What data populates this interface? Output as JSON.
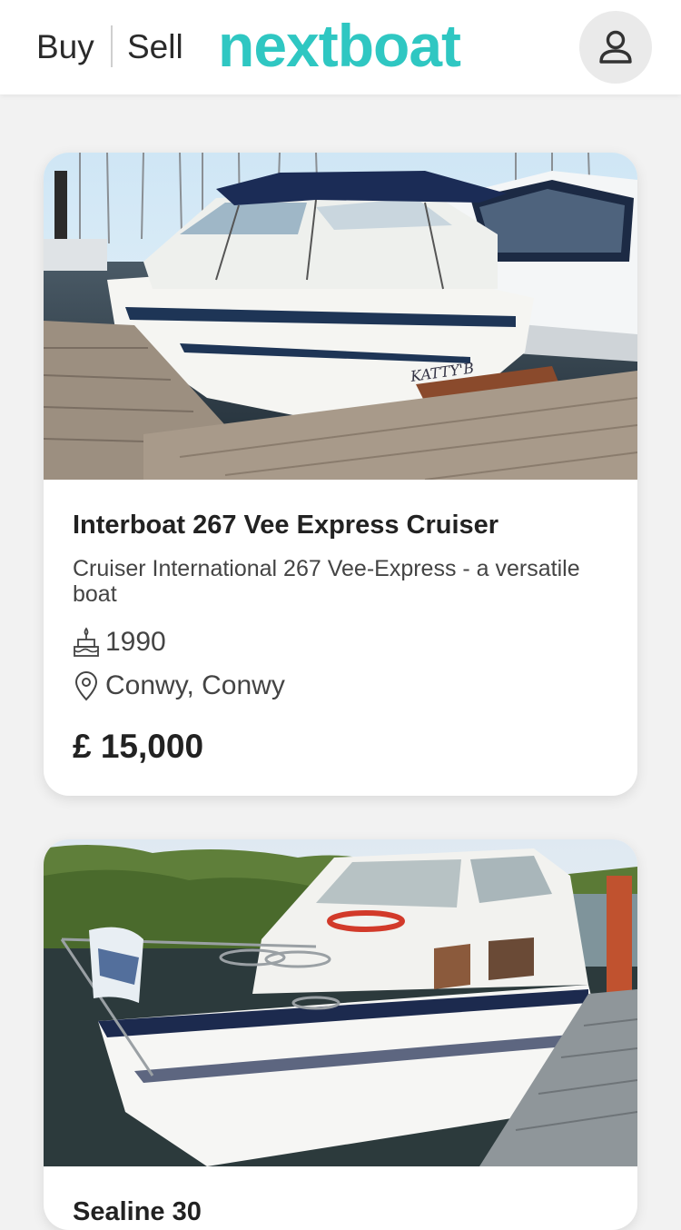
{
  "header": {
    "nav_buy": "Buy",
    "nav_sell": "Sell",
    "logo": "nextboat",
    "account_icon": "user-icon"
  },
  "listings": [
    {
      "title": "Interboat 267 Vee Express Cruiser",
      "description": "Cruiser International 267 Vee-Express - a versatile boat",
      "year": "1990",
      "year_icon": "cake-icon",
      "location": "Conwy, Conwy",
      "location_icon": "location-pin-icon",
      "price": "£ 15,000",
      "boat_name_on_hull": "KATTY'B"
    },
    {
      "title": "Sealine 30"
    }
  ],
  "colors": {
    "brand": "#2fc7c2",
    "page_background": "#f2f2f2",
    "card_background": "#ffffff"
  }
}
